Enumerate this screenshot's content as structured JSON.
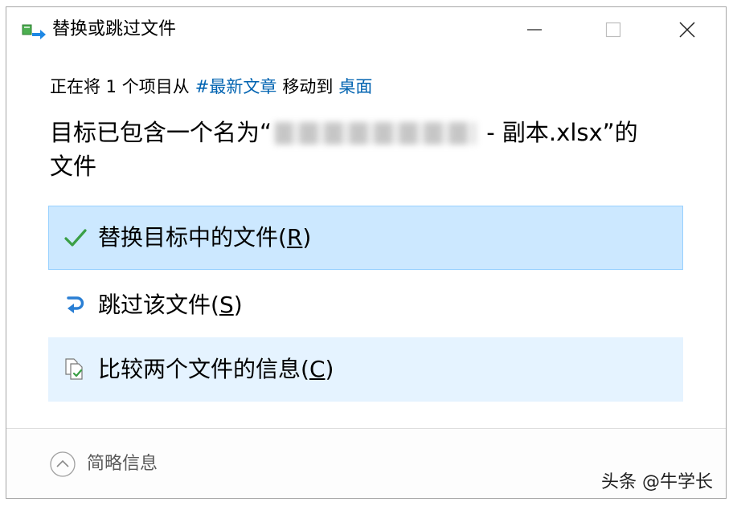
{
  "window": {
    "title": "替换或跳过文件"
  },
  "title_bar": {
    "app_icon": "move-files-icon",
    "minimize_icon": "minimize-icon",
    "maximize_icon": "maximize-icon",
    "close_icon": "close-icon"
  },
  "message": {
    "before": "正在将 1 个项目从",
    "source": "#最新文章",
    "middle": "移动到",
    "destination": "桌面"
  },
  "conflict": {
    "prefix": "目标已包含一个名为“",
    "suffix": " - 副本.xlsx”的",
    "line2": "文件"
  },
  "options": [
    {
      "label": "替换目标中的文件(",
      "accel": "R",
      "close": ")",
      "icon": "check-icon"
    },
    {
      "label": "跳过该文件(",
      "accel": "S",
      "close": ")",
      "icon": "skip-icon"
    },
    {
      "label": "比较两个文件的信息(",
      "accel": "C",
      "close": ")",
      "icon": "compare-icon"
    }
  ],
  "footer": {
    "details_label": "简略信息",
    "icon": "chevron-up-circle-icon"
  },
  "watermark": {
    "text": "头条 @牛学长"
  },
  "colors": {
    "link": "#0063b1",
    "selected_bg": "#cce8ff",
    "selected_border": "#99d1ff",
    "hover_bg": "#e5f3ff",
    "check_green": "#3a9f46",
    "skip_blue": "#2a7fd4"
  }
}
